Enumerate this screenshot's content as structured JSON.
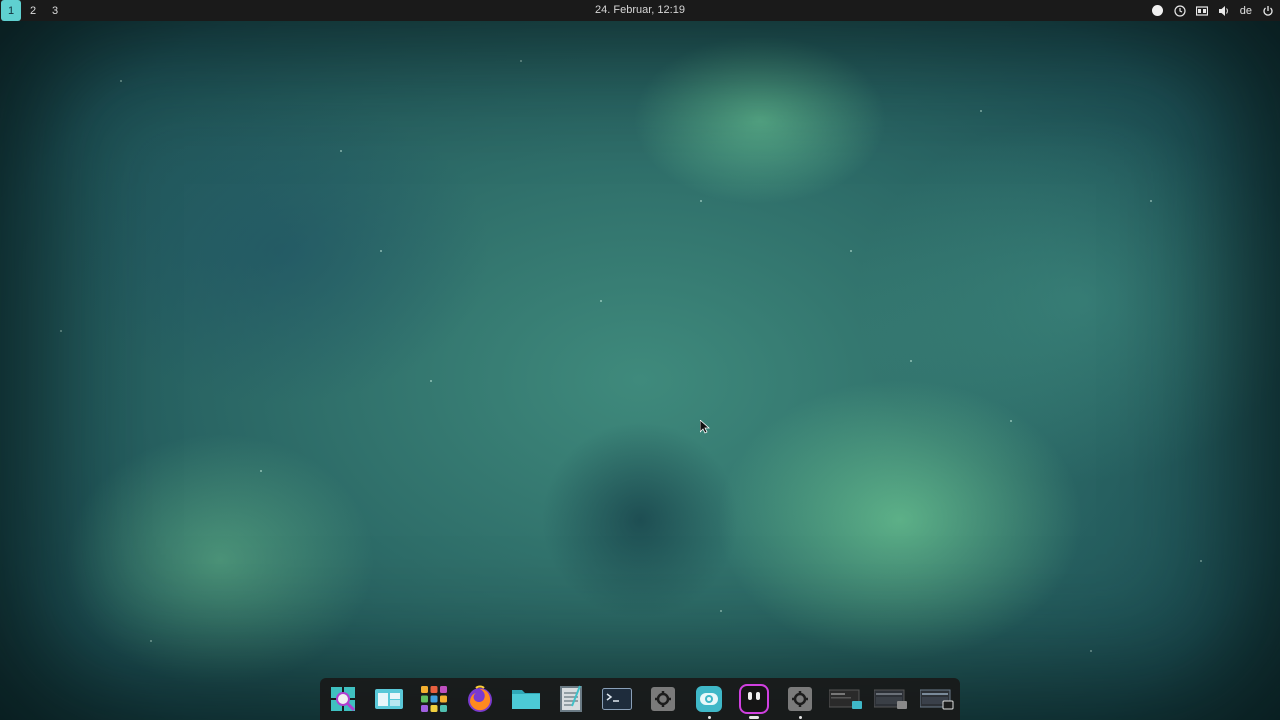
{
  "top_panel": {
    "workspaces": [
      "1",
      "2",
      "3"
    ],
    "active_workspace": "1",
    "clock": "24. Februar, 12:19",
    "tray": {
      "icons": [
        "status-dot-icon",
        "timer-icon",
        "window-icon",
        "volume-icon",
        "power-icon"
      ],
      "language": "de"
    }
  },
  "dock": {
    "items": [
      {
        "name": "search-app",
        "icon": "search-icon"
      },
      {
        "name": "window-switcher",
        "icon": "windows-icon"
      },
      {
        "name": "app-grid",
        "icon": "grid-icon"
      },
      {
        "name": "firefox",
        "icon": "firefox-icon"
      },
      {
        "name": "files",
        "icon": "folder-icon"
      },
      {
        "name": "text-editor",
        "icon": "notepad-icon"
      },
      {
        "name": "terminal",
        "icon": "terminal-icon"
      },
      {
        "name": "settings",
        "icon": "gear-icon"
      },
      {
        "name": "store",
        "icon": "store-icon",
        "running": "dot"
      },
      {
        "name": "chat-app",
        "icon": "robot-icon",
        "running": "bar"
      },
      {
        "name": "settings-2",
        "icon": "gear-icon",
        "running": "dot"
      },
      {
        "name": "window-1",
        "icon": "window-thumbnail-icon"
      },
      {
        "name": "window-2",
        "icon": "window-thumbnail-icon"
      },
      {
        "name": "window-3",
        "icon": "window-thumbnail-icon"
      }
    ]
  },
  "colors": {
    "panel": "#1a1a1a",
    "accent": "#5fd0d0",
    "dock": "#191919"
  }
}
